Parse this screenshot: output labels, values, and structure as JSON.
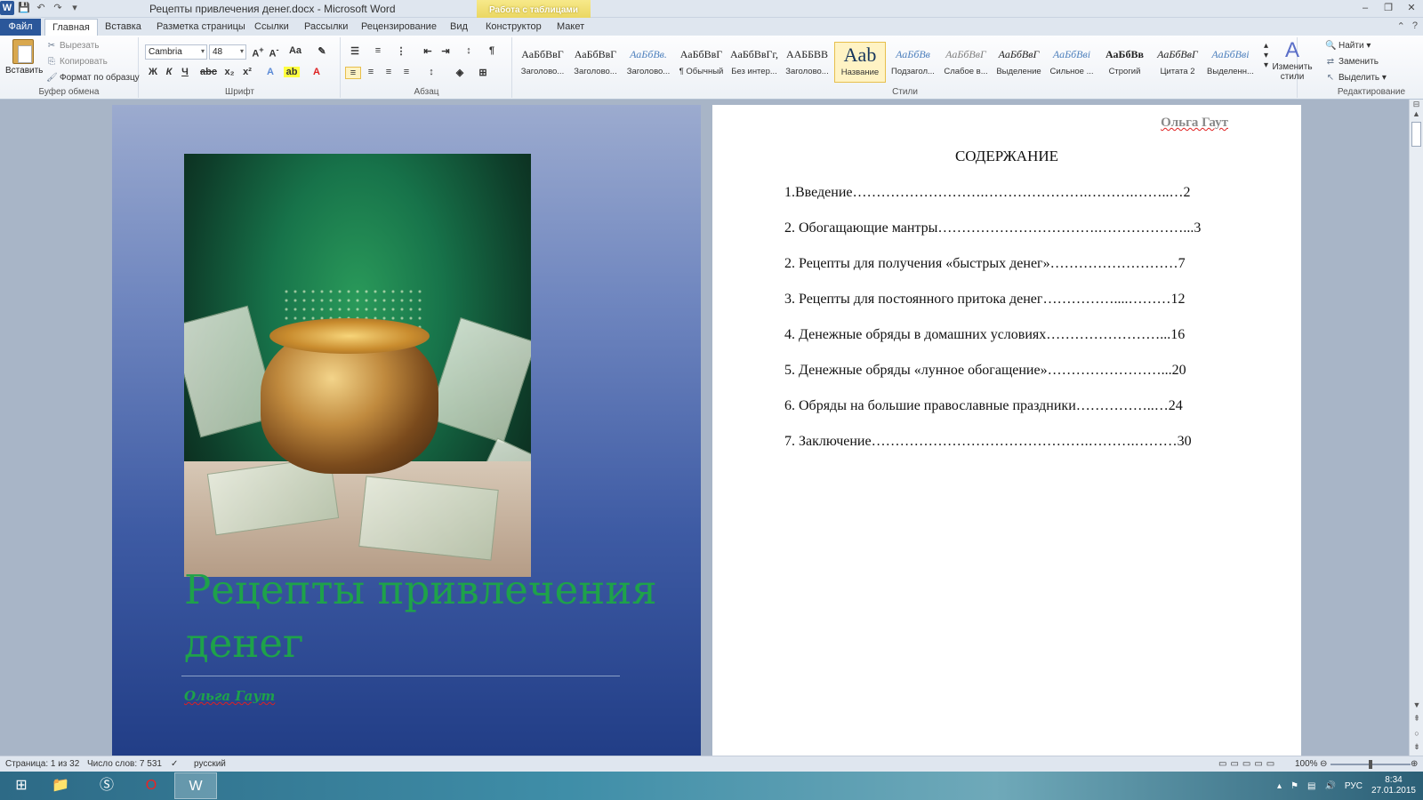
{
  "window": {
    "title": "Рецепты привлечения денег.docx - Microsoft Word",
    "context_tab_header": "Работа с таблицами"
  },
  "tabs": [
    "Файл",
    "Главная",
    "Вставка",
    "Разметка страницы",
    "Ссылки",
    "Рассылки",
    "Рецензирование",
    "Вид",
    "Конструктор",
    "Макет"
  ],
  "ribbon": {
    "clipboard": {
      "paste": "Вставить",
      "cut": "Вырезать",
      "copy": "Копировать",
      "format_painter": "Формат по образцу",
      "label": "Буфер обмена"
    },
    "font": {
      "name": "Cambria",
      "size": "48",
      "label": "Шрифт",
      "bold": "Ж",
      "italic": "К",
      "underline": "Ч"
    },
    "paragraph": {
      "label": "Абзац"
    },
    "styles": {
      "label": "Стили",
      "items": [
        {
          "sample": "АаБбВвГ",
          "name": "Заголово..."
        },
        {
          "sample": "АаБбВвГ",
          "name": "Заголово..."
        },
        {
          "sample": "АаБбВв.",
          "name": "Заголово..."
        },
        {
          "sample": "АаБбВвГ",
          "name": "¶ Обычный"
        },
        {
          "sample": "АаБбВвГг,",
          "name": "Без интер..."
        },
        {
          "sample": "ААББВВ",
          "name": "Заголово..."
        },
        {
          "sample": "Aab",
          "name": "Название"
        },
        {
          "sample": "АаБбВв",
          "name": "Подзагол..."
        },
        {
          "sample": "АаБбВвГ",
          "name": "Слабое в..."
        },
        {
          "sample": "АаБбВвГ",
          "name": "Выделение"
        },
        {
          "sample": "АаБбВві",
          "name": "Сильное ..."
        },
        {
          "sample": "АаБбВв",
          "name": "Строгий"
        },
        {
          "sample": "АаБбВвГ",
          "name": "Цитата 2"
        },
        {
          "sample": "АаБбВві",
          "name": "Выделенн..."
        }
      ],
      "change_styles": "Изменить стили"
    },
    "editing": {
      "label": "Редактирование",
      "find": "Найти",
      "replace": "Заменить",
      "select": "Выделить"
    }
  },
  "cover": {
    "title": "Рецепты привлечения денег",
    "author": "Ольга Гаут"
  },
  "toc_page": {
    "header_author": "Ольга Гаут",
    "heading": "СОДЕРЖАНИЕ",
    "entries": [
      "1.Введение……………………….………………….……….……..…2",
      "2. Обогащающие мантры…………………………….………………...3",
      "2. Рецепты для получения «быстрых денег»………………………7",
      "3. Рецепты для постоянного притока денег……………....………12",
      "4. Денежные обряды в домашних условиях……………………...16",
      "5. Денежные обряды «лунное обогащение»……………………...20",
      "6. Обряды на большие православные праздники……………..…24",
      "7. Заключение……………………………………….……….………30"
    ]
  },
  "statusbar": {
    "page": "Страница: 1 из 32",
    "words": "Число слов: 7 531",
    "language": "русский",
    "zoom": "100%"
  },
  "taskbar": {
    "lang": "РУС",
    "time": "8:34",
    "date": "27.01.2015"
  }
}
